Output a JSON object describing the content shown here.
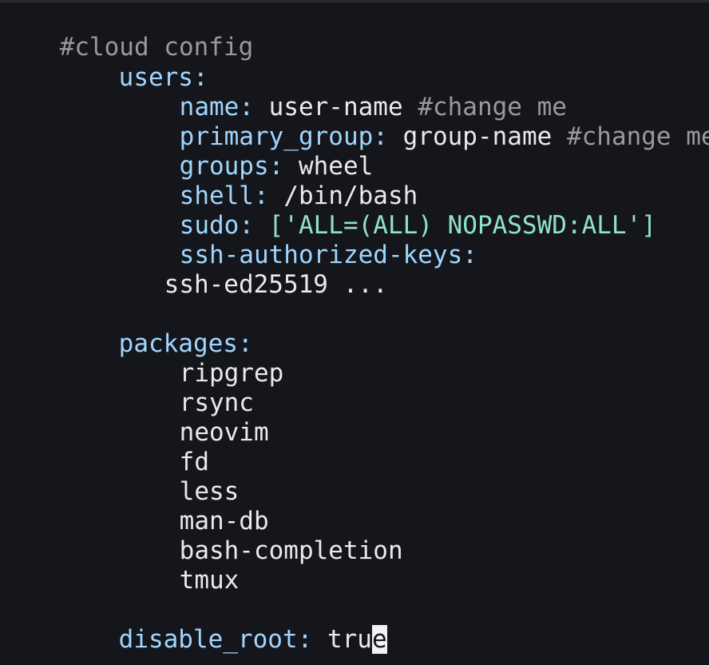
{
  "editor": {
    "lines": {
      "l1": "#cloud config",
      "l2_key": "users",
      "l3_key": "name",
      "l3_val": "user-name",
      "l3_comment": "#change me",
      "l4_key": "primary_group",
      "l4_val": "group-name",
      "l4_comment": "#change me",
      "l5_key": "groups",
      "l5_val": "wheel",
      "l6_key": "shell",
      "l6_val": "/bin/bash",
      "l7_key": "sudo",
      "l7_val": "['ALL=(ALL) NOPASSWD:ALL']",
      "l8_key": "ssh-authorized-keys",
      "l9_val": "ssh-ed25519 ...",
      "l11_key": "packages",
      "packages": [
        "ripgrep",
        "rsync",
        "neovim",
        "fd",
        "less",
        "man-db",
        "bash-completion",
        "tmux"
      ],
      "l21_key": "disable_root",
      "l21_val_prefix": "tru",
      "l21_cursor_char": "e",
      "empty_marker": "~"
    },
    "colon": ":"
  }
}
